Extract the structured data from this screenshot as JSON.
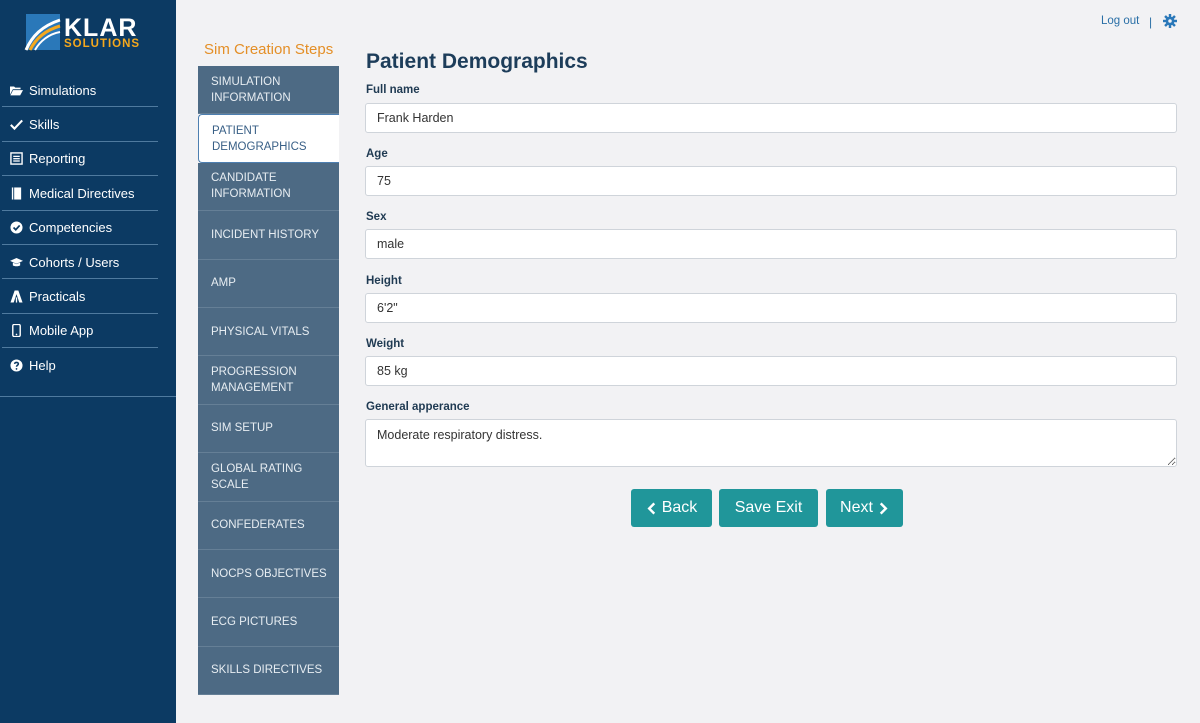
{
  "brand": {
    "name": "KLAR",
    "sub": "SOLUTIONS"
  },
  "nav": {
    "items": [
      {
        "label": "Simulations",
        "icon": "folder-open-icon"
      },
      {
        "label": "Skills",
        "icon": "check-icon"
      },
      {
        "label": "Reporting",
        "icon": "report-icon"
      },
      {
        "label": "Medical Directives",
        "icon": "book-icon"
      },
      {
        "label": "Competencies",
        "icon": "check-circle-icon"
      },
      {
        "label": "Cohorts / Users",
        "icon": "graduation-cap-icon"
      },
      {
        "label": "Practicals",
        "icon": "practicals-icon"
      },
      {
        "label": "Mobile App",
        "icon": "mobile-icon"
      },
      {
        "label": "Help",
        "icon": "question-circle-icon"
      }
    ]
  },
  "steps": {
    "title": "Sim Creation Steps",
    "items": [
      "SIMULATION INFORMATION",
      "PATIENT DEMOGRAPHICS",
      "CANDIDATE INFORMATION",
      "INCIDENT HISTORY",
      "AMP",
      "PHYSICAL VITALS",
      "PROGRESSION MANAGEMENT",
      "SIM SETUP",
      "GLOBAL RATING SCALE",
      "CONFEDERATES",
      "NOCPS OBJECTIVES",
      "ECG PICTURES",
      "SKILLS DIRECTIVES"
    ],
    "active_index": 1
  },
  "header": {
    "logout": "Log out",
    "separator": "|",
    "settings_icon": "gear-icon"
  },
  "form": {
    "title": "Patient Demographics",
    "full_name": {
      "label": "Full name",
      "value": "Frank Harden"
    },
    "age": {
      "label": "Age",
      "value": "75"
    },
    "sex": {
      "label": "Sex",
      "value": "male"
    },
    "height": {
      "label": "Height",
      "value": "6'2\""
    },
    "weight": {
      "label": "Weight",
      "value": "85 kg"
    },
    "appearance": {
      "label": "General apperance",
      "value": "Moderate respiratory distress."
    }
  },
  "buttons": {
    "back": "Back",
    "save_exit": "Save Exit",
    "next": "Next"
  },
  "colors": {
    "sidebar": "#0c3a63",
    "accent": "#20969a",
    "steps_bg": "#4d6a84",
    "steps_title": "#e48f27"
  }
}
